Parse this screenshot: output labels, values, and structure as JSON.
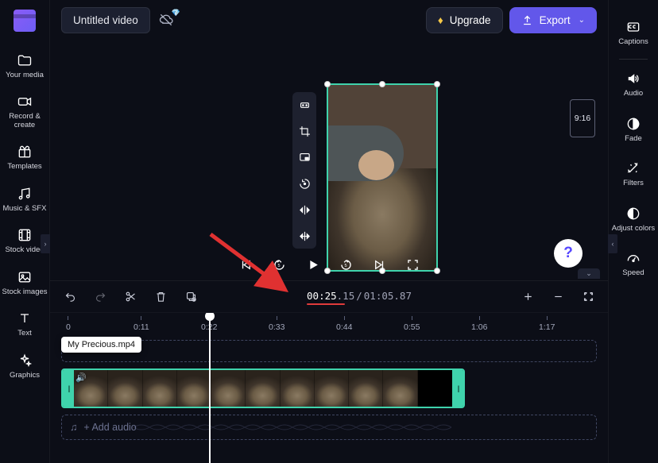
{
  "header": {
    "project_title": "Untitled video",
    "upgrade_label": "Upgrade",
    "export_label": "Export",
    "aspect_label": "9:16"
  },
  "left_nav": {
    "items": [
      {
        "label": "Your media",
        "icon": "folder-icon"
      },
      {
        "label": "Record & create",
        "icon": "camera-icon"
      },
      {
        "label": "Templates",
        "icon": "gift-icon"
      },
      {
        "label": "Music & SFX",
        "icon": "music-icon"
      },
      {
        "label": "Stock video",
        "icon": "film-icon"
      },
      {
        "label": "Stock images",
        "icon": "image-icon"
      },
      {
        "label": "Text",
        "icon": "text-icon"
      },
      {
        "label": "Graphics",
        "icon": "sparkle-icon"
      }
    ]
  },
  "right_nav": {
    "items": [
      {
        "label": "Captions",
        "icon": "captions-icon"
      },
      {
        "label": "Audio",
        "icon": "audio-icon"
      },
      {
        "label": "Fade",
        "icon": "fade-icon"
      },
      {
        "label": "Filters",
        "icon": "filters-icon"
      },
      {
        "label": "Adjust colors",
        "icon": "adjust-colors-icon"
      },
      {
        "label": "Speed",
        "icon": "speed-icon"
      }
    ]
  },
  "playback": {
    "time_current": "00:25",
    "time_current_frac": ".15",
    "time_total": "01:05",
    "time_total_frac": ".87"
  },
  "timeline": {
    "ruler_ticks": [
      "0",
      "0:11",
      "0:22",
      "0:33",
      "0:44",
      "0:55",
      "1:06",
      "1:17"
    ],
    "clip_filename": "My Precious.mp4",
    "add_audio_label": "+ Add audio"
  },
  "help": {
    "label": "?"
  }
}
